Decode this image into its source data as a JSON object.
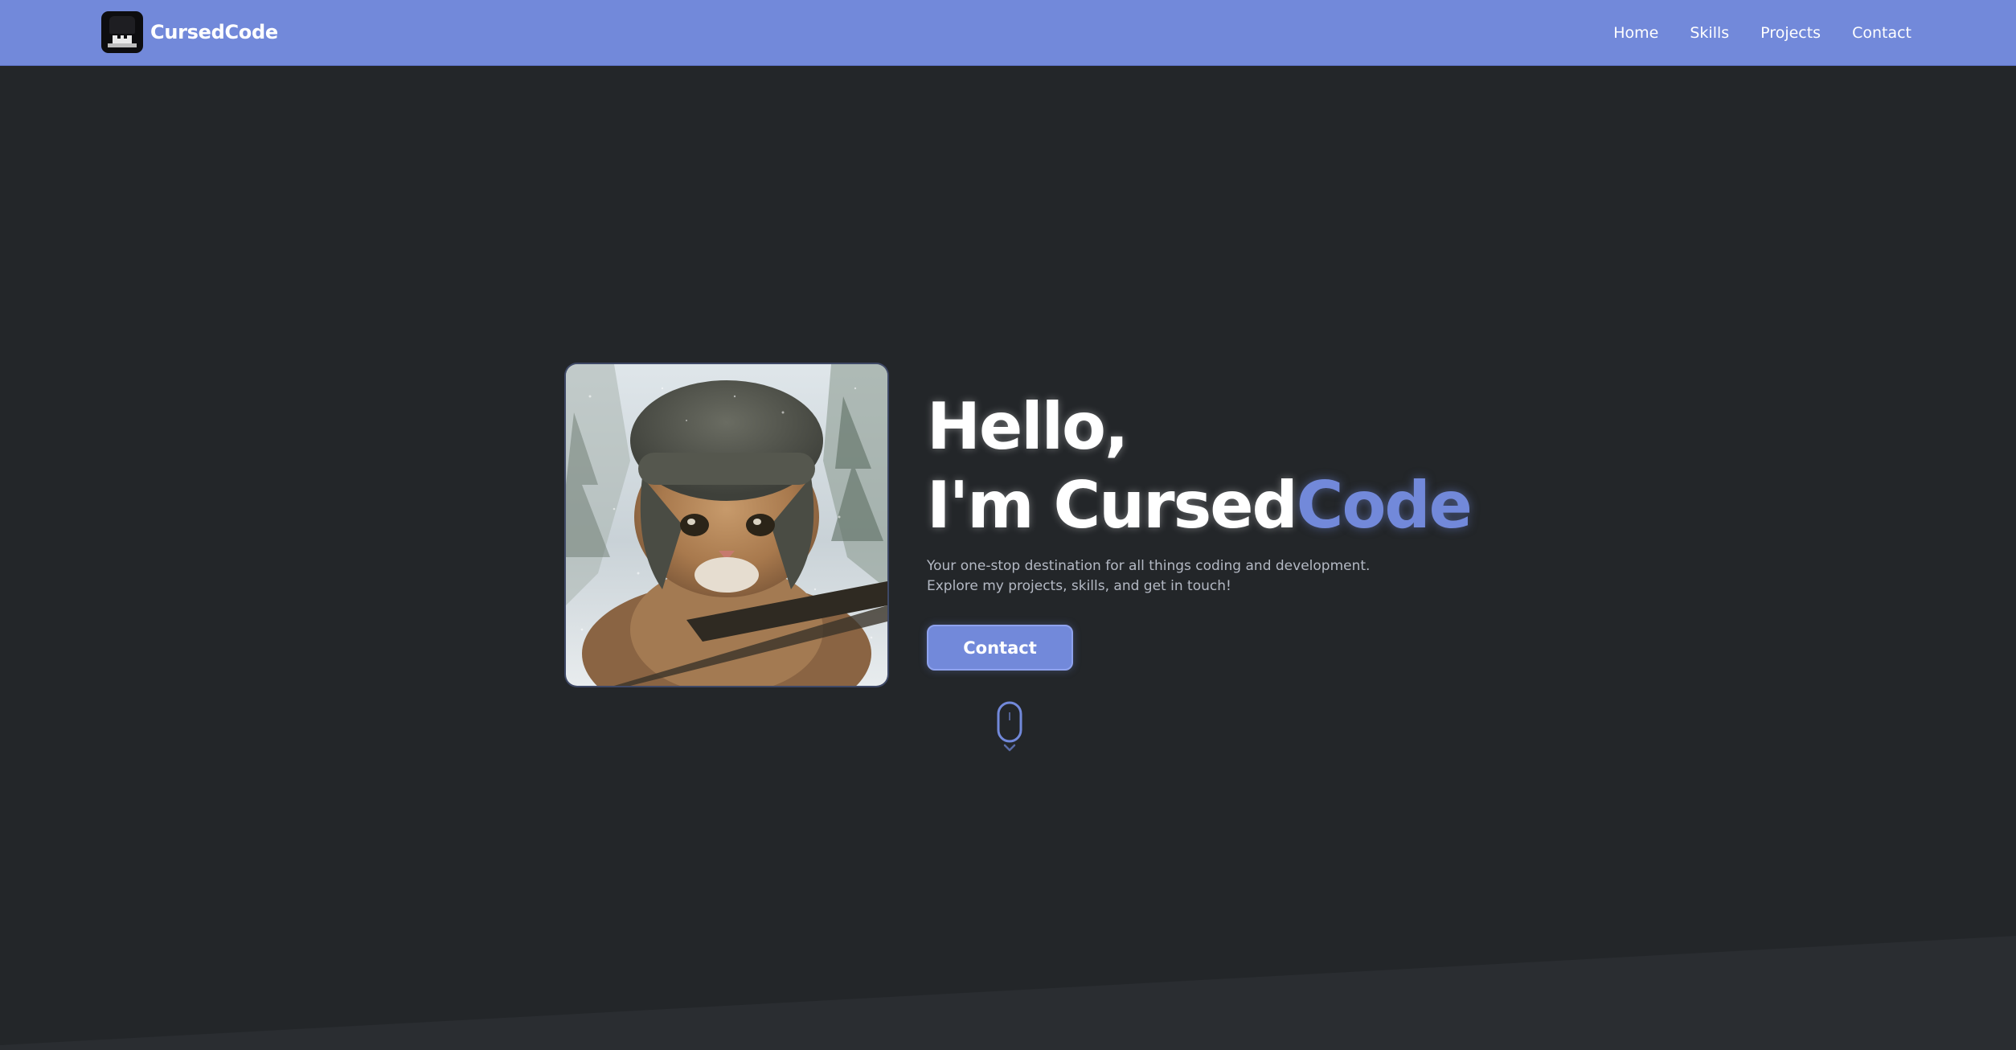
{
  "brand": {
    "name": "CursedCode",
    "logo_icon": "pixel-avatar-logo"
  },
  "nav": {
    "items": [
      {
        "label": "Home"
      },
      {
        "label": "Skills"
      },
      {
        "label": "Projects"
      },
      {
        "label": "Contact"
      }
    ]
  },
  "hero": {
    "image_icon": "cat-in-winter-hat-photo",
    "title_line1": "Hello,",
    "title_line2_prefix": "I'm Cursed",
    "title_line2_accent": "Code",
    "description": "Your one-stop destination for all things coding and development. Explore my projects, skills, and get in touch!",
    "cta_label": "Contact",
    "scroll_icon": "mouse-scroll-icon"
  },
  "colors": {
    "accent": "#7289da",
    "background": "#232629",
    "background_alt": "#2a2d31",
    "text_primary": "#ffffff",
    "text_muted": "#b4b9c4"
  }
}
